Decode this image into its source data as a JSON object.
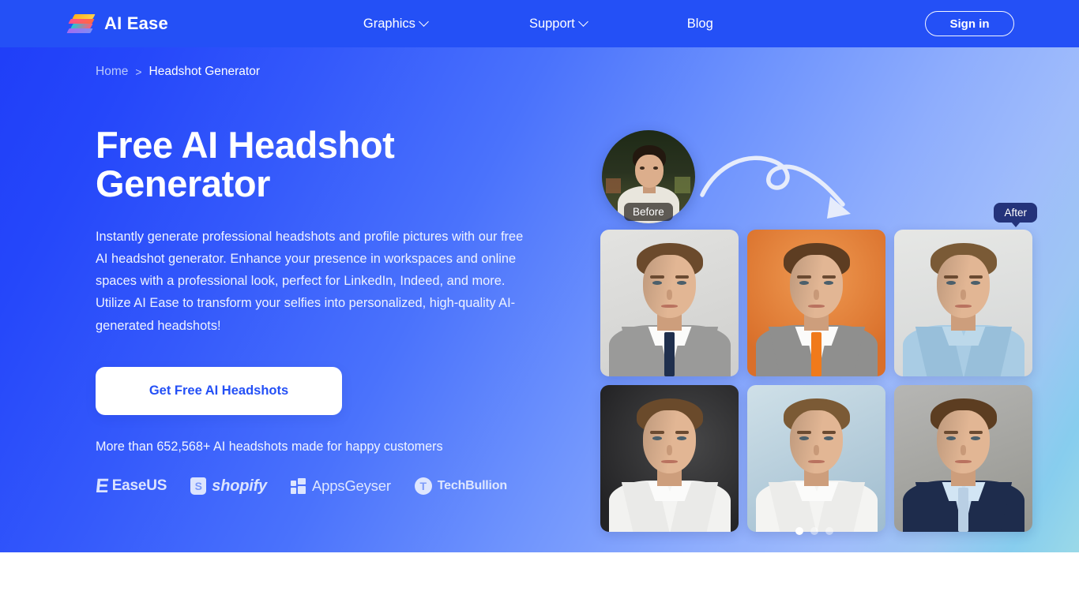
{
  "header": {
    "brand_name": "AI Ease",
    "logo_icon": "ai-ease-wing-logo",
    "nav": [
      {
        "label": "Graphics",
        "has_dropdown": true,
        "icon": "chevron-down-icon"
      },
      {
        "label": "Support",
        "has_dropdown": true,
        "icon": "chevron-down-icon"
      },
      {
        "label": "Blog",
        "has_dropdown": false,
        "icon": ""
      }
    ],
    "signin_label": "Sign in",
    "bg_color": "#2450f6"
  },
  "breadcrumb": {
    "home": "Home",
    "separator": ">",
    "current": "Headshot Generator"
  },
  "hero": {
    "title": "Free AI Headshot Generator",
    "description": "Instantly generate professional headshots and profile pictures with our free AI headshot generator. Enhance your presence in workspaces and online spaces with a professional look, perfect for LinkedIn, Indeed, and more. Utilize AI Ease to transform your selfies into personalized, high-quality AI-generated headshots!",
    "cta_label": "Get Free AI Headshots",
    "cta_text_color": "#2450f6",
    "stat_text": "More than 652,568+ AI headshots made for happy customers",
    "gradient_start": "#1f3df8",
    "gradient_end": "#9ad9e8"
  },
  "brand_logos": [
    {
      "name": "EaseUS",
      "icon": "easeus-e-icon"
    },
    {
      "name": "shopify",
      "icon": "shopify-bag-icon"
    },
    {
      "name": "AppsGeyser",
      "icon": "appsgeyser-grid-icon"
    },
    {
      "name": "TechBullion",
      "icon": "techbullion-t-icon"
    }
  ],
  "showcase": {
    "before_label": "Before",
    "after_label": "After",
    "after_badge_color": "#24337a",
    "arrow_icon": "curved-loop-arrow-icon",
    "before_image_alt": "original selfie portrait",
    "results": [
      {
        "alt": "headshot gray background gray suit navy tie",
        "bg": "#dcdcda",
        "jacket": "#9a9a99",
        "tie": "#1f2f4d",
        "shirt": "#f6f6f4",
        "hair": "#6b4a2c",
        "type": "suit"
      },
      {
        "alt": "headshot orange background gray suit orange tie",
        "bg": "#e2803a",
        "jacket": "#8f8f8e",
        "tie": "#f07a1b",
        "shirt": "#f7f6f3",
        "hair": "#5d3d22",
        "type": "suit"
      },
      {
        "alt": "headshot light background light blue shirt",
        "bg": "#dfe0de",
        "jacket": "#8cb5d6",
        "tie": "",
        "shirt": "#a9cce4",
        "hair": "#7a5a36",
        "type": "shirt"
      },
      {
        "alt": "headshot dark background white shirt",
        "bg": "#2f2f31",
        "jacket": "#f2f2f0",
        "tie": "",
        "shirt": "#f4f4f2",
        "hair": "#6a4a2b",
        "type": "shirt"
      },
      {
        "alt": "headshot blue background white shirt",
        "bg": "#b7cfdd",
        "jacket": "#f4f4f2",
        "tie": "",
        "shirt": "#f6f6f4",
        "hair": "#7b5a35",
        "type": "shirt"
      },
      {
        "alt": "headshot gray background navy suit",
        "bg": "#a8a8a6",
        "jacket": "#1e2c4c",
        "tie": "#b9cfe4",
        "shirt": "#c6dcef",
        "hair": "#5c3d21",
        "type": "suit"
      }
    ],
    "carousel": {
      "total_dots": 3,
      "active_index": 0
    }
  }
}
